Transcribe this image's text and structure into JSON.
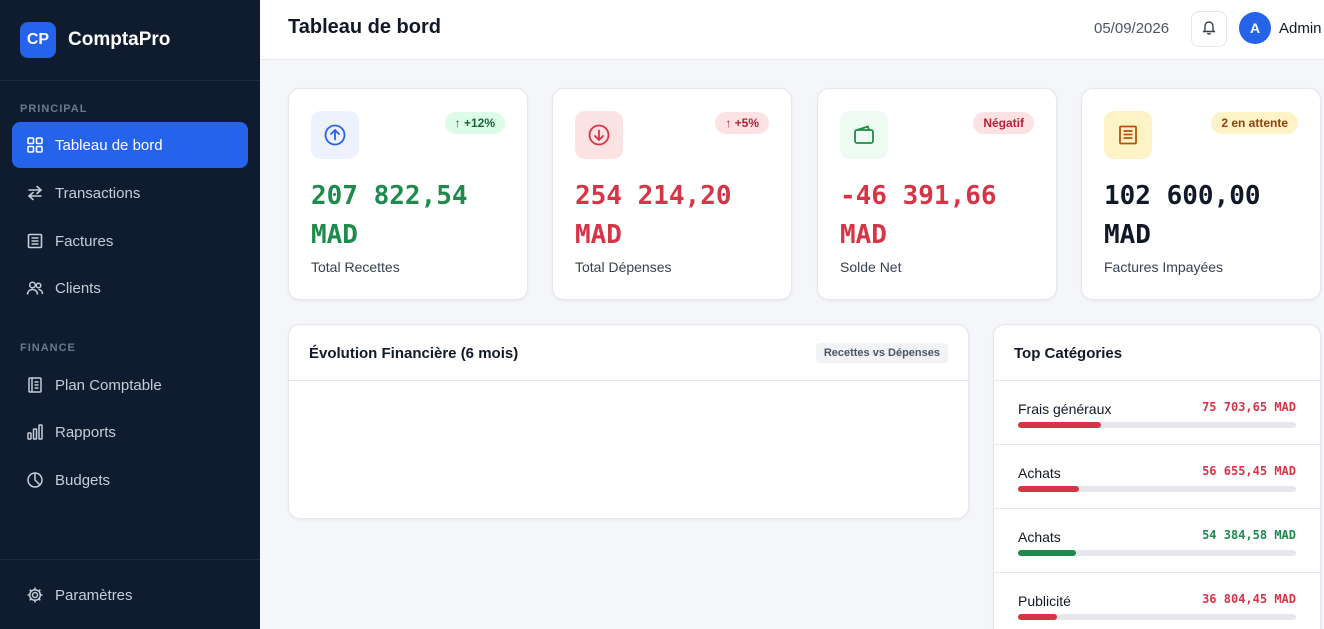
{
  "brand": {
    "logo_text": "CP",
    "name": "ComptaPro",
    "accent": "#2563eb"
  },
  "sidebar": {
    "sections": [
      {
        "label": "PRINCIPAL"
      },
      {
        "label": "FINANCE"
      }
    ],
    "items": [
      {
        "label": "Tableau de bord",
        "icon": "grid-icon",
        "active": true
      },
      {
        "label": "Transactions",
        "icon": "arrows-swap-icon"
      },
      {
        "label": "Factures",
        "icon": "invoice-icon"
      },
      {
        "label": "Clients",
        "icon": "users-icon"
      },
      {
        "label": "Plan Comptable",
        "icon": "ledger-icon"
      },
      {
        "label": "Rapports",
        "icon": "bar-chart-icon"
      },
      {
        "label": "Budgets",
        "icon": "pie-chart-icon"
      }
    ],
    "footer": {
      "label": "Paramètres",
      "icon": "gear-icon"
    }
  },
  "header": {
    "title": "Tableau de bord",
    "date": "05/09/2026",
    "user": {
      "initial": "A",
      "name": "Admin"
    }
  },
  "stats": [
    {
      "label": "Total Recettes",
      "value_line1": "207 822,54",
      "value_line2": "MAD",
      "badge": "↑ +12%",
      "icon": "arrow-up-circle-icon",
      "value_color": "#1e8a4c",
      "badge_bg": "#dcfce7",
      "badge_color": "#166534",
      "icon_bg": "#eef2ff",
      "icon_color": "#2563eb"
    },
    {
      "label": "Total Dépenses",
      "value_line1": "254 214,20",
      "value_line2": "MAD",
      "badge": "↑ +5%",
      "icon": "arrow-down-circle-icon",
      "value_color": "#d63447",
      "badge_bg": "#fde2e4",
      "badge_color": "#b42335",
      "icon_bg": "#fde2e4",
      "icon_color": "#d63447"
    },
    {
      "label": "Solde Net",
      "value_line1": "-46 391,66",
      "value_line2": "MAD",
      "badge": "Négatif",
      "icon": "wallet-icon",
      "value_color": "#d63447",
      "badge_bg": "#fde2e4",
      "badge_color": "#b42335",
      "icon_bg": "#eefbf2",
      "icon_color": "#1e8a4c"
    },
    {
      "label": "Factures Impayées",
      "value_line1": "102 600,00",
      "value_line2": "MAD",
      "badge": "2 en attente",
      "icon": "invoice-icon",
      "value_color": "#111827",
      "badge_bg": "#fef3c7",
      "badge_color": "#92400e",
      "icon_bg": "#fef3c7",
      "icon_color": "#b45309"
    }
  ],
  "chart_panel": {
    "title": "Évolution Financière (6 mois)",
    "chip": "Recettes vs Dépenses"
  },
  "top_categories": {
    "title": "Top Catégories",
    "items": [
      {
        "name": "Frais généraux",
        "amount": "75 703,65 MAD",
        "color": "#d63447",
        "share": 0.3
      },
      {
        "name": "Achats",
        "amount": "56 655,45 MAD",
        "color": "#d63447",
        "share": 0.22
      },
      {
        "name": "Achats",
        "amount": "54 384,58 MAD",
        "color": "#1e8a4c",
        "share": 0.21
      },
      {
        "name": "Publicité",
        "amount": "36 804,45 MAD",
        "color": "#d63447",
        "share": 0.14
      }
    ]
  }
}
